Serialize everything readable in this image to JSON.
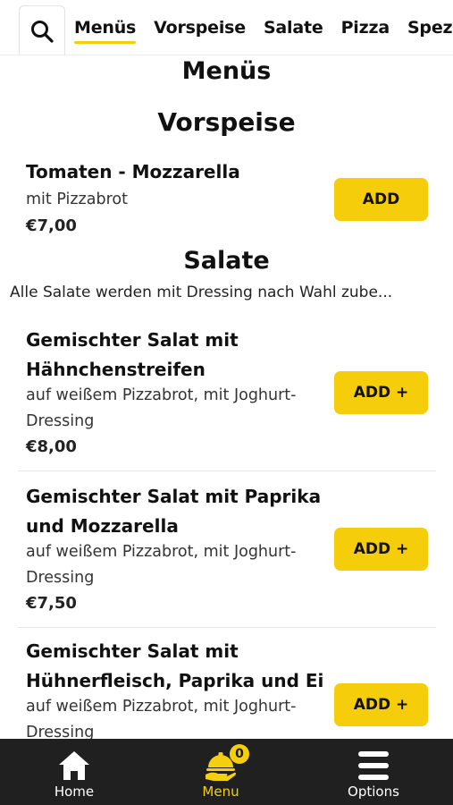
{
  "tabs": [
    "Menüs",
    "Vorspeise",
    "Salate",
    "Pizza",
    "Spezial-"
  ],
  "sections": {
    "menus": {
      "title": "Menüs"
    },
    "vorspeise": {
      "title": "Vorspeise"
    },
    "salate": {
      "title": "Salate",
      "description": "Alle Salate werden mit Dressing nach Wahl zube..."
    }
  },
  "items": [
    {
      "name": "Tomaten - Mozzarella",
      "description": "mit Pizzabrot",
      "price": "€7,00",
      "button": "ADD"
    },
    {
      "name": "Gemischter Salat mit Hähnchenstreifen",
      "description": "auf weißem Pizzabrot, mit Joghurt-Dressing",
      "price": "€8,00",
      "button": "ADD +"
    },
    {
      "name": "Gemischter Salat mit Paprika und Mozzarella",
      "description": "auf weißem Pizzabrot, mit Joghurt-Dressing",
      "price": "€7,50",
      "button": "ADD +"
    },
    {
      "name": "Gemischter Salat mit Hühnerfleisch, Paprika und Ei",
      "description": "auf weißem Pizzabrot, mit Joghurt-Dressing",
      "price": "",
      "button": "ADD +"
    }
  ],
  "nav": {
    "home": "Home",
    "menu": "Menu",
    "options": "Options",
    "cart_count": "0"
  },
  "icons": {
    "search": "search-icon",
    "home": "home-icon",
    "menu": "food-tray-icon",
    "options": "hamburger-icon"
  },
  "colors": {
    "accent": "#f5cf0e",
    "nav_bg": "#202020"
  }
}
